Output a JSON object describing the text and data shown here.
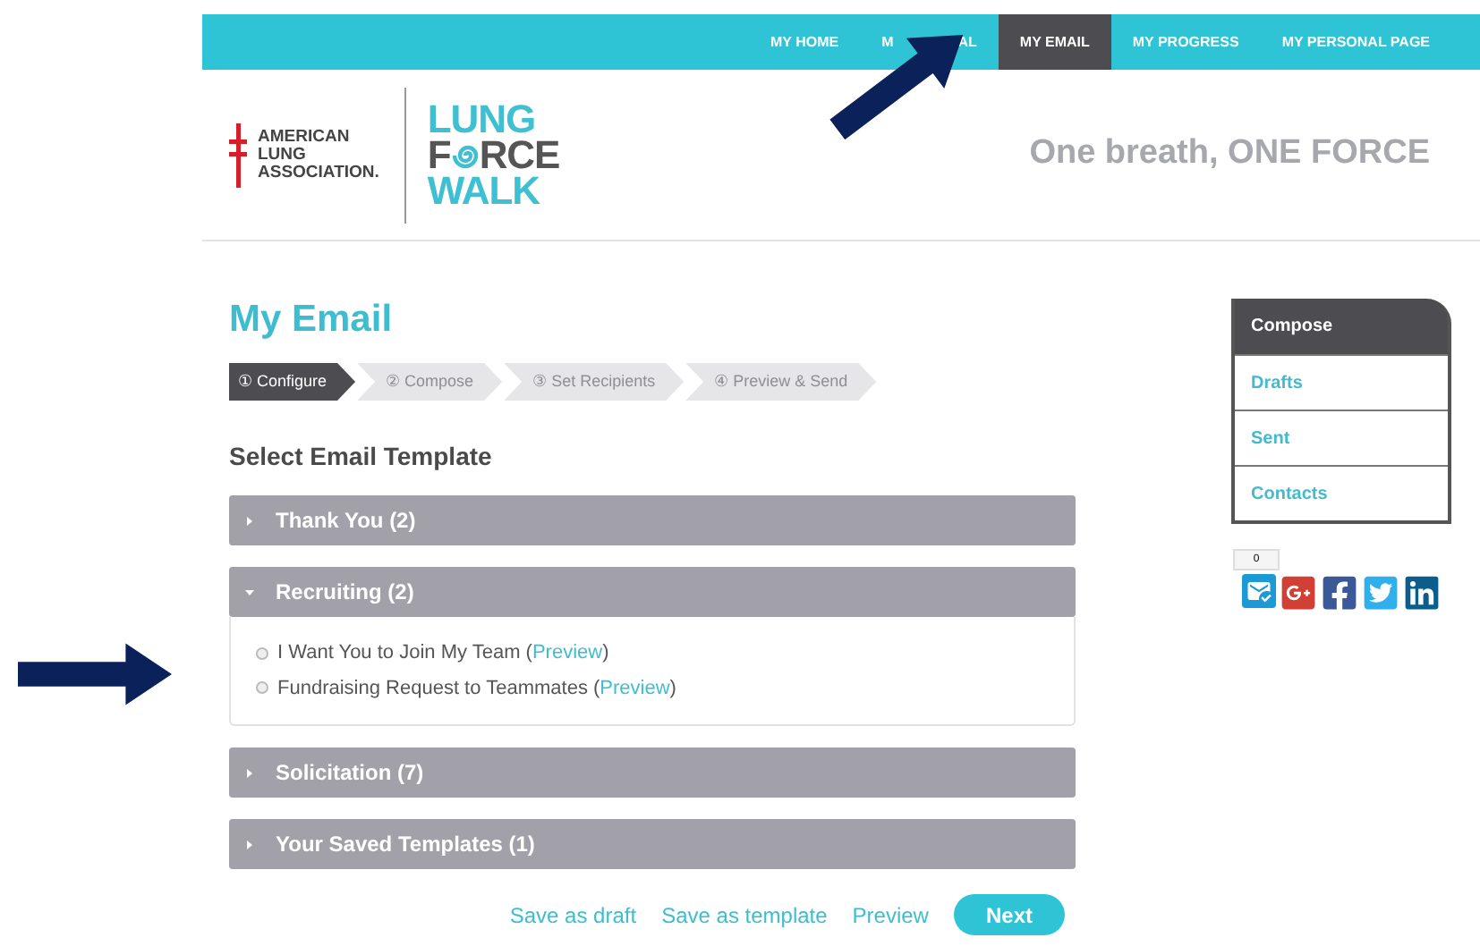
{
  "nav": [
    {
      "kind": "full",
      "label": "MY HOME",
      "selected": false
    },
    {
      "kind": "covered",
      "label_start": "M",
      "label_end": "AL",
      "selected": false
    },
    {
      "kind": "full",
      "label": "MY EMAIL",
      "selected": true
    },
    {
      "kind": "full",
      "label": "MY PROGRESS",
      "selected": false
    },
    {
      "kind": "full",
      "label": "MY PERSONAL PAGE",
      "selected": false
    }
  ],
  "header": {
    "org_lines": [
      "AMERICAN",
      "LUNG",
      "ASSOCIATION."
    ],
    "walk_logo": {
      "line1": "LUNG",
      "line2_start": "F",
      "line2_end": "RCE",
      "line3": "WALK"
    },
    "tagline": "One breath, ONE FORCE"
  },
  "title": "My Email",
  "steps": [
    {
      "label": "① Configure",
      "selected": true
    },
    {
      "label": "② Compose",
      "selected": false
    },
    {
      "label": "③ Set Recipients",
      "selected": false
    },
    {
      "label": "④ Preview & Send",
      "selected": false
    }
  ],
  "section_title": "Select Email Template",
  "groups": [
    {
      "label": "Thank You (2)",
      "expanded": false
    },
    {
      "label": "Recruiting (2)",
      "expanded": true,
      "templates": [
        {
          "name": "I Want You to Join My Team (",
          "link": "Preview",
          "after": ")",
          "selected": false
        },
        {
          "name": "Fundraising Request to Teammates (",
          "link": "Preview",
          "after": ")",
          "selected": false
        }
      ]
    },
    {
      "label": "Solicitation (7)",
      "expanded": false
    },
    {
      "label": "Your Saved Templates (1)",
      "expanded": false
    }
  ],
  "actions": [
    {
      "kind": "link",
      "label": "Save as draft"
    },
    {
      "kind": "link",
      "label": "Save as template"
    },
    {
      "kind": "link",
      "label": "Preview"
    },
    {
      "kind": "primary",
      "label": "Next"
    }
  ],
  "sidebar": {
    "items": [
      {
        "label": "Compose",
        "selected": true
      },
      {
        "label": "Drafts",
        "selected": false
      },
      {
        "label": "Sent",
        "selected": false
      },
      {
        "label": "Contacts",
        "selected": false
      }
    ]
  },
  "share": {
    "count": "0"
  }
}
